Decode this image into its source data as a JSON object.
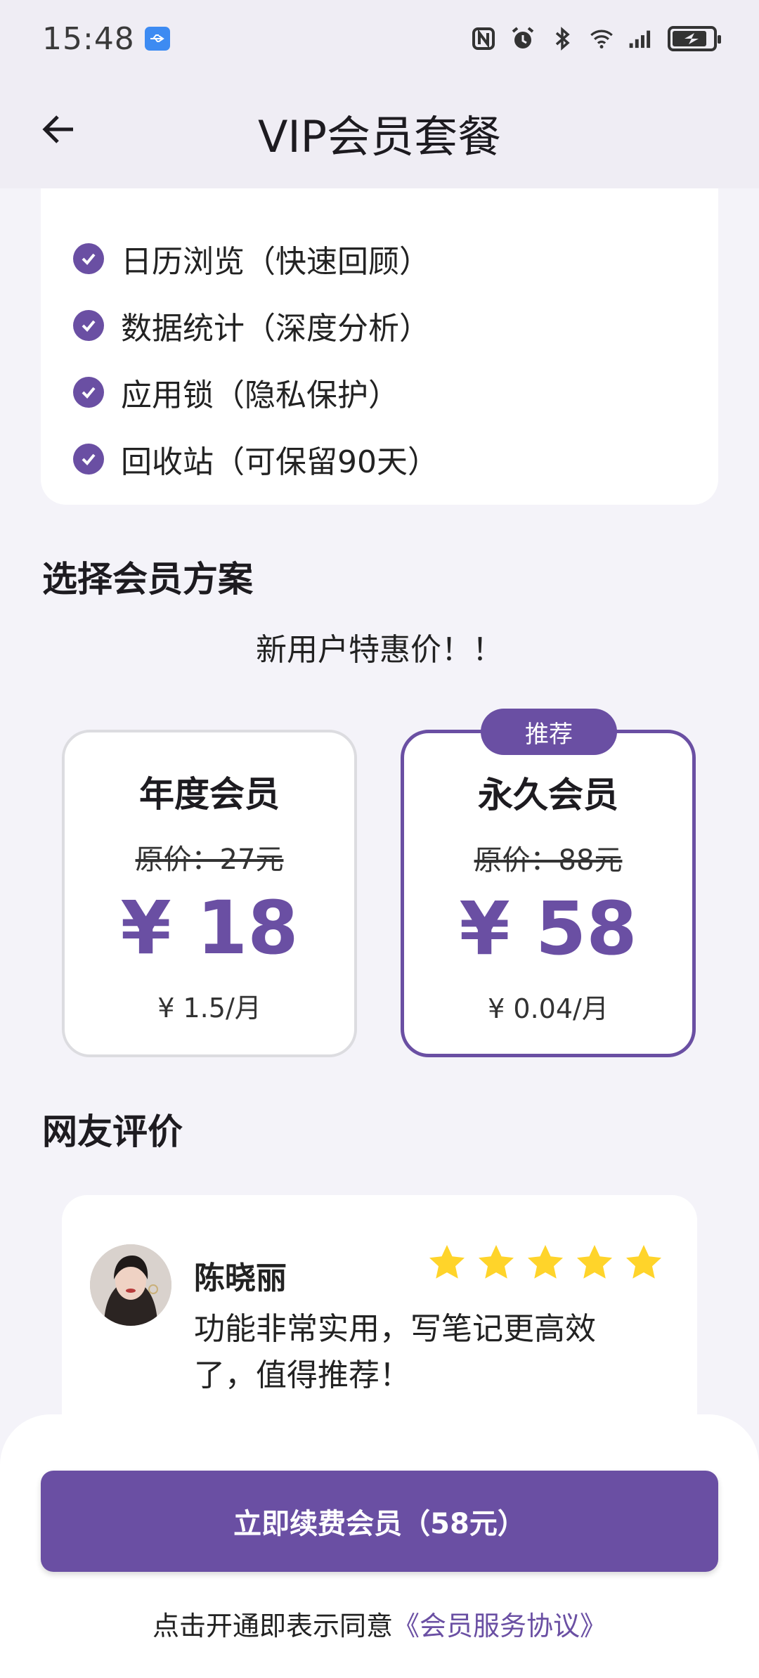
{
  "status": {
    "time": "15:48"
  },
  "app_bar": {
    "title": "VIP会员套餐"
  },
  "features": [
    "日历浏览（快速回顾）",
    "数据统计（深度分析）",
    "应用锁（隐私保护）",
    "回收站（可保留90天）"
  ],
  "plans": {
    "section_title": "选择会员方案",
    "promo": "新用户特惠价！！",
    "annual": {
      "name": "年度会员",
      "original": "原价：27元",
      "price": "¥ 18",
      "monthly": "¥ 1.5/月"
    },
    "lifetime": {
      "name": "永久会员",
      "original": "原价：88元",
      "price": "¥ 58",
      "monthly": "¥ 0.04/月",
      "badge": "推荐"
    }
  },
  "reviews": {
    "section_title": "网友评价",
    "items": [
      {
        "name": "陈晓丽",
        "rating": 5,
        "text": "功能非常实用，写笔记更高效了，值得推荐！"
      }
    ]
  },
  "footer": {
    "cta": "立即续费会员（58元）",
    "agree_prefix": "点击开通即表示同意",
    "agree_link": "《会员服务协议》"
  },
  "colors": {
    "accent": "#6a4fa3",
    "star": "#ffd42a",
    "background": "#f4f3f9"
  }
}
